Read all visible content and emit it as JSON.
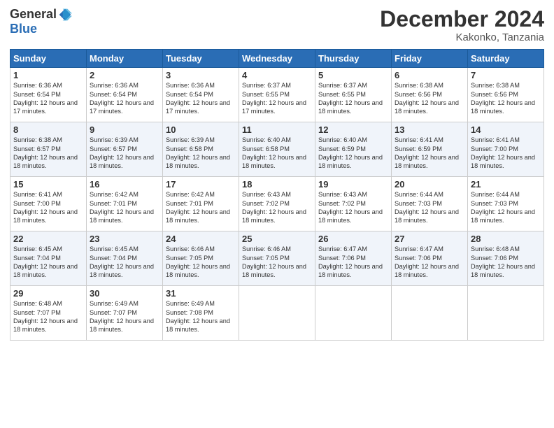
{
  "logo": {
    "general": "General",
    "blue": "Blue"
  },
  "title": "December 2024",
  "location": "Kakonko, Tanzania",
  "days_header": [
    "Sunday",
    "Monday",
    "Tuesday",
    "Wednesday",
    "Thursday",
    "Friday",
    "Saturday"
  ],
  "weeks": [
    [
      {
        "day": "1",
        "rise": "6:36 AM",
        "set": "6:54 PM",
        "hours": "12 hours and 17 minutes."
      },
      {
        "day": "2",
        "rise": "6:36 AM",
        "set": "6:54 PM",
        "hours": "12 hours and 17 minutes."
      },
      {
        "day": "3",
        "rise": "6:36 AM",
        "set": "6:54 PM",
        "hours": "12 hours and 17 minutes."
      },
      {
        "day": "4",
        "rise": "6:37 AM",
        "set": "6:55 PM",
        "hours": "12 hours and 17 minutes."
      },
      {
        "day": "5",
        "rise": "6:37 AM",
        "set": "6:55 PM",
        "hours": "12 hours and 18 minutes."
      },
      {
        "day": "6",
        "rise": "6:38 AM",
        "set": "6:56 PM",
        "hours": "12 hours and 18 minutes."
      },
      {
        "day": "7",
        "rise": "6:38 AM",
        "set": "6:56 PM",
        "hours": "12 hours and 18 minutes."
      }
    ],
    [
      {
        "day": "8",
        "rise": "6:38 AM",
        "set": "6:57 PM",
        "hours": "12 hours and 18 minutes."
      },
      {
        "day": "9",
        "rise": "6:39 AM",
        "set": "6:57 PM",
        "hours": "12 hours and 18 minutes."
      },
      {
        "day": "10",
        "rise": "6:39 AM",
        "set": "6:58 PM",
        "hours": "12 hours and 18 minutes."
      },
      {
        "day": "11",
        "rise": "6:40 AM",
        "set": "6:58 PM",
        "hours": "12 hours and 18 minutes."
      },
      {
        "day": "12",
        "rise": "6:40 AM",
        "set": "6:59 PM",
        "hours": "12 hours and 18 minutes."
      },
      {
        "day": "13",
        "rise": "6:41 AM",
        "set": "6:59 PM",
        "hours": "12 hours and 18 minutes."
      },
      {
        "day": "14",
        "rise": "6:41 AM",
        "set": "7:00 PM",
        "hours": "12 hours and 18 minutes."
      }
    ],
    [
      {
        "day": "15",
        "rise": "6:41 AM",
        "set": "7:00 PM",
        "hours": "12 hours and 18 minutes."
      },
      {
        "day": "16",
        "rise": "6:42 AM",
        "set": "7:01 PM",
        "hours": "12 hours and 18 minutes."
      },
      {
        "day": "17",
        "rise": "6:42 AM",
        "set": "7:01 PM",
        "hours": "12 hours and 18 minutes."
      },
      {
        "day": "18",
        "rise": "6:43 AM",
        "set": "7:02 PM",
        "hours": "12 hours and 18 minutes."
      },
      {
        "day": "19",
        "rise": "6:43 AM",
        "set": "7:02 PM",
        "hours": "12 hours and 18 minutes."
      },
      {
        "day": "20",
        "rise": "6:44 AM",
        "set": "7:03 PM",
        "hours": "12 hours and 18 minutes."
      },
      {
        "day": "21",
        "rise": "6:44 AM",
        "set": "7:03 PM",
        "hours": "12 hours and 18 minutes."
      }
    ],
    [
      {
        "day": "22",
        "rise": "6:45 AM",
        "set": "7:04 PM",
        "hours": "12 hours and 18 minutes."
      },
      {
        "day": "23",
        "rise": "6:45 AM",
        "set": "7:04 PM",
        "hours": "12 hours and 18 minutes."
      },
      {
        "day": "24",
        "rise": "6:46 AM",
        "set": "7:05 PM",
        "hours": "12 hours and 18 minutes."
      },
      {
        "day": "25",
        "rise": "6:46 AM",
        "set": "7:05 PM",
        "hours": "12 hours and 18 minutes."
      },
      {
        "day": "26",
        "rise": "6:47 AM",
        "set": "7:06 PM",
        "hours": "12 hours and 18 minutes."
      },
      {
        "day": "27",
        "rise": "6:47 AM",
        "set": "7:06 PM",
        "hours": "12 hours and 18 minutes."
      },
      {
        "day": "28",
        "rise": "6:48 AM",
        "set": "7:06 PM",
        "hours": "12 hours and 18 minutes."
      }
    ],
    [
      {
        "day": "29",
        "rise": "6:48 AM",
        "set": "7:07 PM",
        "hours": "12 hours and 18 minutes."
      },
      {
        "day": "30",
        "rise": "6:49 AM",
        "set": "7:07 PM",
        "hours": "12 hours and 18 minutes."
      },
      {
        "day": "31",
        "rise": "6:49 AM",
        "set": "7:08 PM",
        "hours": "12 hours and 18 minutes."
      },
      null,
      null,
      null,
      null
    ]
  ],
  "labels": {
    "sunrise": "Sunrise:",
    "sunset": "Sunset:",
    "daylight": "Daylight:"
  }
}
